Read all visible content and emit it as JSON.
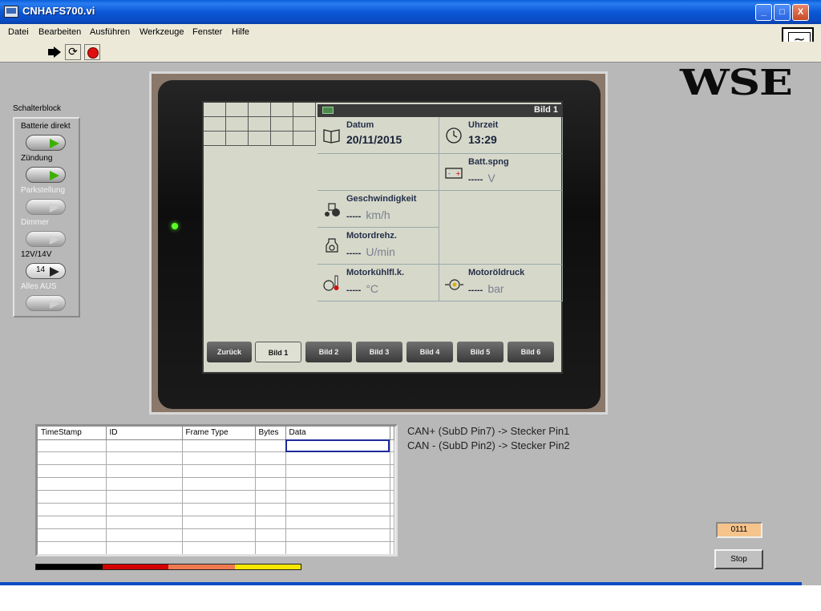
{
  "window": {
    "title": "CNHAFS700.vi",
    "minimize": "_",
    "maximize": "□",
    "close": "X"
  },
  "menu": [
    "Datei",
    "Bearbeiten",
    "Ausführen",
    "Werkzeuge",
    "Fenster",
    "Hilfe"
  ],
  "toolbar": {
    "run_icon": "run-arrow-icon",
    "run_continuous_icon": "run-continuous-icon",
    "abort_icon": "abort-stop-icon",
    "run_continuous_glyph": "⟳"
  },
  "logo": "WSE",
  "switch_block": {
    "title": "Schalterblock",
    "switches": [
      {
        "label": "Batterie direkt",
        "on": true,
        "value": ""
      },
      {
        "label": "Zündung",
        "on": true,
        "value": ""
      },
      {
        "label": "Parkstellung",
        "on": false,
        "value": ""
      },
      {
        "label": "Dimmer",
        "on": false,
        "value": ""
      },
      {
        "label": "12V/14V",
        "on": true,
        "value": "14"
      },
      {
        "label": "Alles AUS",
        "on": false,
        "value": ""
      }
    ]
  },
  "terminal": {
    "header": "Bild 1",
    "cells": {
      "datum": {
        "label": "Datum",
        "value": "20/11/2015"
      },
      "uhrzeit": {
        "label": "Uhrzeit",
        "value": "13:29"
      },
      "batt": {
        "label": "Batt.spng",
        "value": "-----",
        "unit": "V"
      },
      "speed": {
        "label": "Geschwindigkeit",
        "value": "-----",
        "unit": "km/h"
      },
      "rpm": {
        "label": "Motordrehz.",
        "value": "-----",
        "unit": "U/min"
      },
      "coolant": {
        "label": "Motorkühlfl.k.",
        "value": "-----",
        "unit": "°C"
      },
      "oil": {
        "label": "Motoröldruck",
        "value": "-----",
        "unit": "bar"
      }
    },
    "tabs": [
      "Zurück",
      "Bild 1",
      "Bild 2",
      "Bild 3",
      "Bild 4",
      "Bild 5",
      "Bild 6"
    ]
  },
  "can_table": {
    "columns": [
      "TimeStamp",
      "ID",
      "Frame Type",
      "Bytes",
      "Data"
    ]
  },
  "notes": [
    "CAN+ (SubD Pin7) -> Stecker Pin1",
    "CAN - (SubD Pin2) -> Stecker Pin2"
  ],
  "counter": "0111",
  "stop_label": "Stop",
  "colors": {
    "bar": [
      "#000000",
      "#d40000",
      "#f07a50",
      "#f8e800"
    ],
    "title_bar": "#0a5fd8",
    "counter_bg": "#f5c38c"
  }
}
